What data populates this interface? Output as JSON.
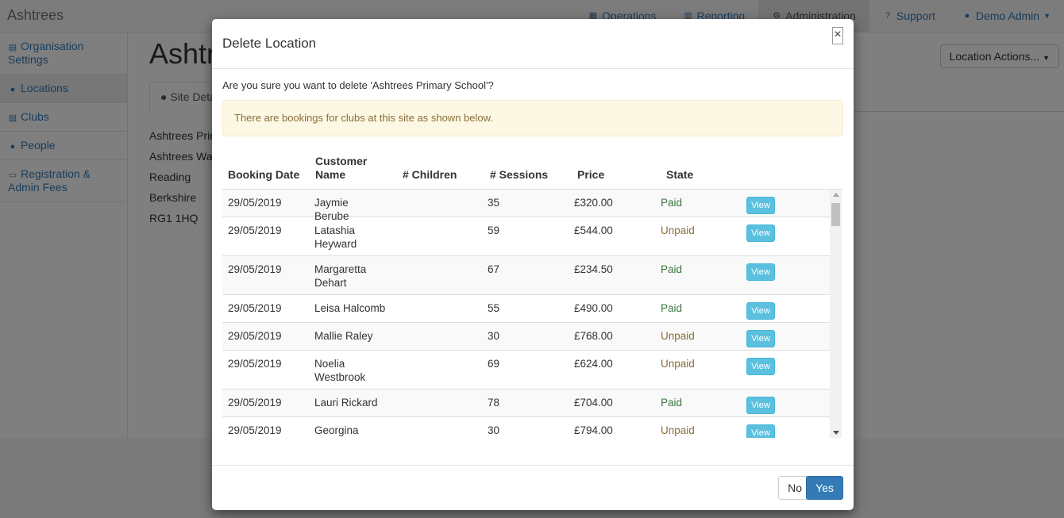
{
  "app": {
    "brand": "Ashtrees",
    "nav": [
      {
        "label": "Operations",
        "icon": "grid-icon"
      },
      {
        "label": "Reporting",
        "icon": "bar-chart-icon"
      },
      {
        "label": "Administration",
        "icon": "gear-icon"
      },
      {
        "label": "Support",
        "icon": "question-icon"
      },
      {
        "label": "Demo Admin",
        "icon": "user-icon"
      }
    ]
  },
  "sidebar": {
    "items": [
      {
        "label": "Organisation Settings",
        "icon": "building-icon"
      },
      {
        "label": "Locations",
        "icon": "map-marker-icon"
      },
      {
        "label": "Clubs",
        "icon": "building-icon"
      },
      {
        "label": "People",
        "icon": "users-icon"
      },
      {
        "label": "Registration & Admin Fees",
        "icon": "money-icon"
      }
    ]
  },
  "page": {
    "title": "Ashtrees Primary School",
    "location_actions": "Location Actions...",
    "tab": "Site Details",
    "address": [
      "Ashtrees Primary School",
      "Ashtrees Way",
      "Reading",
      "Berkshire",
      "RG1 1HQ"
    ]
  },
  "modal": {
    "title": "Delete Location",
    "close": "×",
    "confirm": "Are you sure you want to delete 'Ashtrees Primary School'?",
    "alert": "There are bookings for clubs at this site as shown below.",
    "headers": {
      "date": "Booking Date",
      "customer": "Customer Name",
      "children": "# Children",
      "sessions": "# Sessions",
      "price": "Price",
      "state": "State"
    },
    "view_label": "View",
    "rows": [
      {
        "date": "29/05/2019",
        "customer": "Jaymie Berube",
        "children": "",
        "sessions": "35",
        "price": "£320.00",
        "state": "Paid"
      },
      {
        "date": "29/05/2019",
        "customer": "Latashia Heyward",
        "children": "",
        "sessions": "59",
        "price": "£544.00",
        "state": "Unpaid"
      },
      {
        "date": "29/05/2019",
        "customer": "Margaretta Dehart",
        "children": "",
        "sessions": "67",
        "price": "£234.50",
        "state": "Paid"
      },
      {
        "date": "29/05/2019",
        "customer": "Leisa Halcomb",
        "children": "",
        "sessions": "55",
        "price": "£490.00",
        "state": "Paid"
      },
      {
        "date": "29/05/2019",
        "customer": "Mallie Raley",
        "children": "",
        "sessions": "30",
        "price": "£768.00",
        "state": "Unpaid"
      },
      {
        "date": "29/05/2019",
        "customer": "Noelia Westbrook",
        "children": "",
        "sessions": "69",
        "price": "£624.00",
        "state": "Unpaid"
      },
      {
        "date": "29/05/2019",
        "customer": "Lauri Rickard",
        "children": "",
        "sessions": "78",
        "price": "£704.00",
        "state": "Paid"
      },
      {
        "date": "29/05/2019",
        "customer": "Georgina Olivo",
        "children": "",
        "sessions": "30",
        "price": "£794.00",
        "state": "Unpaid"
      }
    ],
    "no_label": "No",
    "yes_label": "Yes"
  },
  "colors": {
    "accent": "#337ab7",
    "info_button": "#5bc0de",
    "paid": "#3c763d",
    "unpaid": "#8a6d3b",
    "alert_bg": "#fcf8e3"
  }
}
